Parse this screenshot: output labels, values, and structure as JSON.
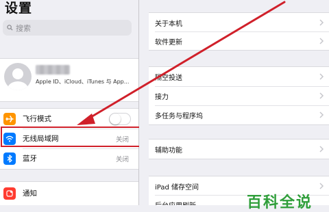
{
  "sidebar": {
    "title": "设置",
    "search_placeholder": "搜索",
    "profile": {
      "subtitle": "Apple ID、iCloud、iTunes 与 App..."
    },
    "items": [
      {
        "label": "飞行模式",
        "value": "",
        "icon": "airplane-icon",
        "color": "#ff9500",
        "toggle": false
      },
      {
        "label": "无线局域网",
        "value": "关闭",
        "icon": "wifi-icon",
        "color": "#007aff"
      },
      {
        "label": "蓝牙",
        "value": "关闭",
        "icon": "bluetooth-icon",
        "color": "#007aff"
      },
      {
        "label": "通知",
        "value": "",
        "icon": "notifications-icon",
        "color": "#ff3b30"
      }
    ]
  },
  "detail": {
    "group1": [
      "关于本机",
      "软件更新"
    ],
    "group2": [
      "隔空投送",
      "接力",
      "多任务与程序坞"
    ],
    "group3": [
      "辅助功能"
    ],
    "group4": [
      "iPad 储存空间",
      "后台应用刷新"
    ]
  },
  "watermark": "百科全说",
  "colors": {
    "highlight": "#d0202a",
    "arrow": "#d0202a",
    "watermark": "#2f9e3a"
  }
}
